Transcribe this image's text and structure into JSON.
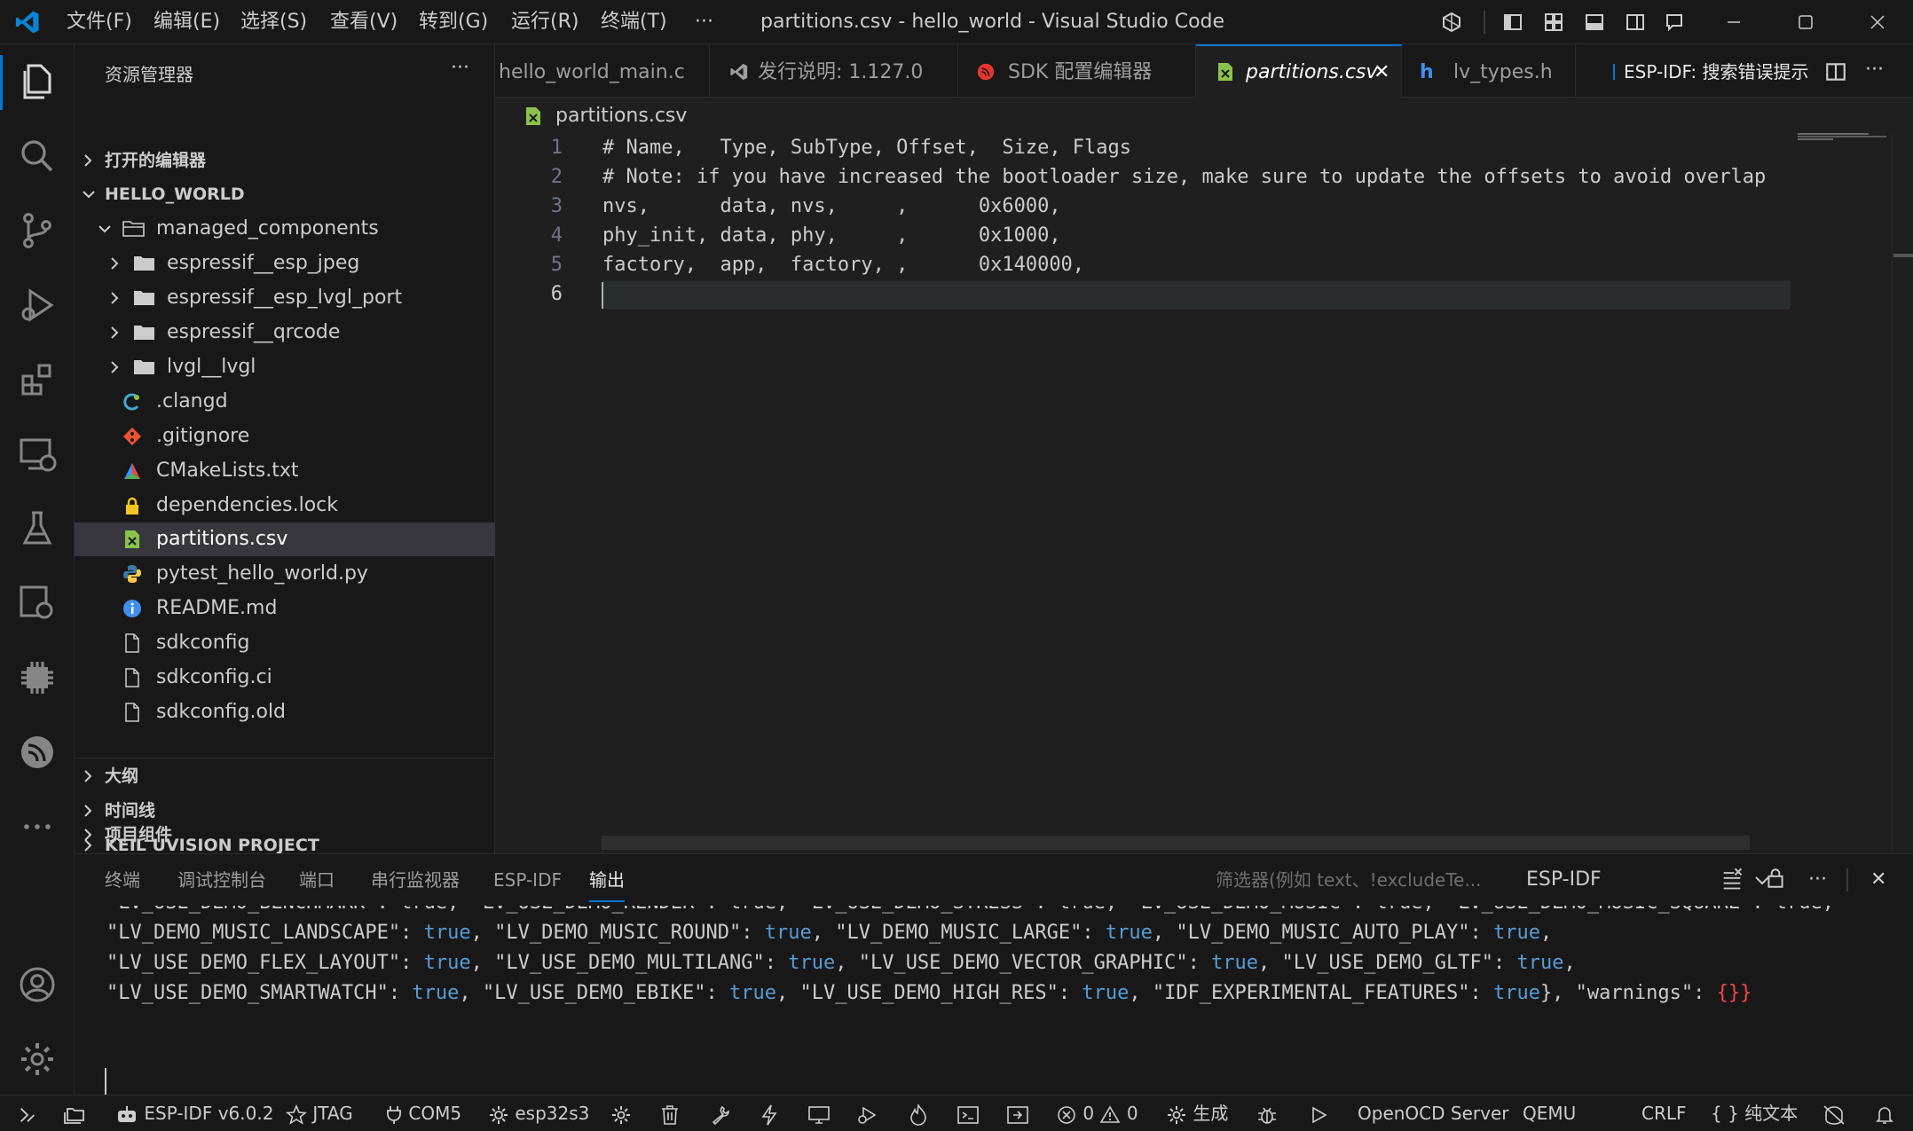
{
  "window": {
    "title": "partitions.csv - hello_world - Visual Studio Code",
    "menu": [
      "文件(F)",
      "编辑(E)",
      "选择(S)",
      "查看(V)",
      "转到(G)",
      "运行(R)",
      "终端(T)",
      "···"
    ]
  },
  "sidebar": {
    "title": "资源管理器",
    "more": "···",
    "sections": {
      "open_editors": "打开的编辑器",
      "workspace": "HELLO_WORLD",
      "outline": "大纲",
      "timeline": "时间线",
      "keil": "KEIL UVISION PROJECT",
      "components": "项目组件"
    },
    "tree": [
      {
        "label": "managed_components",
        "type": "folder-open"
      },
      {
        "label": "espressif__esp_jpeg",
        "type": "folder"
      },
      {
        "label": "espressif__esp_lvgl_port",
        "type": "folder"
      },
      {
        "label": "espressif__qrcode",
        "type": "folder"
      },
      {
        "label": "lvgl__lvgl",
        "type": "folder"
      },
      {
        "label": ".clangd",
        "type": "clangd"
      },
      {
        "label": ".gitignore",
        "type": "git"
      },
      {
        "label": "CMakeLists.txt",
        "type": "cmake"
      },
      {
        "label": "dependencies.lock",
        "type": "lock"
      },
      {
        "label": "partitions.csv",
        "type": "csv"
      },
      {
        "label": "pytest_hello_world.py",
        "type": "python"
      },
      {
        "label": "README.md",
        "type": "info"
      },
      {
        "label": "sdkconfig",
        "type": "file"
      },
      {
        "label": "sdkconfig.ci",
        "type": "file"
      },
      {
        "label": "sdkconfig.old",
        "type": "file"
      }
    ]
  },
  "tabs": [
    {
      "label": "hello_world_main.c"
    },
    {
      "label": "发行说明: 1.127.0"
    },
    {
      "label": "SDK 配置编辑器"
    },
    {
      "label": "partitions.csv",
      "close": "✕"
    },
    {
      "label": "lv_types.h"
    }
  ],
  "tab_actions": {
    "espidf_hint": "ESP-IDF: 搜索错误提示",
    "more": "···"
  },
  "editor": {
    "breadcrumb": "partitions.csv",
    "lines": [
      {
        "n": "1",
        "text": "# Name,   Type, SubType, Offset,  Size, Flags"
      },
      {
        "n": "2",
        "text": "# Note: if you have increased the bootloader size, make sure to update the offsets to avoid overlap"
      },
      {
        "n": "3",
        "text": "nvs,      data, nvs,     ,      0x6000,"
      },
      {
        "n": "4",
        "text": "phy_init, data, phy,     ,      0x1000,"
      },
      {
        "n": "5",
        "text": "factory,  app,  factory, ,      0x140000,"
      },
      {
        "n": "6",
        "text": ""
      }
    ]
  },
  "panel": {
    "tabs": [
      "终端",
      "调试控制台",
      "端口",
      "串行监视器",
      "ESP-IDF",
      "输出"
    ],
    "filter_placeholder": "筛选器(例如 text、!excludeTe...",
    "output_channel": "ESP-IDF",
    "output_lines": {
      "l0": "\"LV_USE_DEMO_BENCHMARK\": true, \"LV_USE_DEMO_RENDER\": true, \"LV_USE_DEMO_STRESS\": true, \"LV_USE_DEMO_MUSIC\": true, \"LV_USE_DEMO_MUSIC_SQUARE\": true,",
      "l1a": "\"LV_DEMO_MUSIC_LANDSCAPE\": ",
      "l1b": "true",
      "l1c": ", \"LV_DEMO_MUSIC_ROUND\": ",
      "l1d": "true",
      "l1e": ", \"LV_DEMO_MUSIC_LARGE\": ",
      "l1f": "true",
      "l1g": ", \"LV_DEMO_MUSIC_AUTO_PLAY\": ",
      "l1h": "true",
      "l1i": ",",
      "l2a": "\"LV_USE_DEMO_FLEX_LAYOUT\": ",
      "l2b": "true",
      "l2c": ", \"LV_USE_DEMO_MULTILANG\": ",
      "l2d": "true",
      "l2e": ", \"LV_USE_DEMO_VECTOR_GRAPHIC\": ",
      "l2f": "true",
      "l2g": ", \"LV_USE_DEMO_GLTF\": ",
      "l2h": "true",
      "l2i": ",",
      "l3a": "\"LV_USE_DEMO_SMARTWATCH\": ",
      "l3b": "true",
      "l3c": ", \"LV_USE_DEMO_EBIKE\": ",
      "l3d": "true",
      "l3e": ", \"LV_USE_DEMO_HIGH_RES\": ",
      "l3f": "true",
      "l3g": ", \"IDF_EXPERIMENTAL_FEATURES\": ",
      "l3h": "true",
      "l3i": "}, \"warnings\": ",
      "l3j": "{}",
      "l3k": "}"
    },
    "more": "···",
    "close": "✕"
  },
  "statusbar": {
    "idf_version": "ESP-IDF v6.0.2",
    "jtag": "JTAG",
    "port": "COM5",
    "target": "esp32s3",
    "errors": "0",
    "warnings": "0",
    "build": "生成",
    "openocd": "OpenOCD Server",
    "qemu": "QEMU",
    "eol": "CRLF",
    "language": "纯文本",
    "language_icon": "{ }"
  },
  "colors": {
    "accent": "#0078d4",
    "bg": "#1f1f1f",
    "chrome": "#181818",
    "keyword": "#569cd6"
  }
}
